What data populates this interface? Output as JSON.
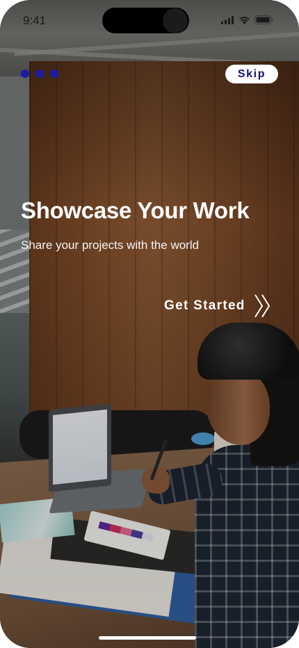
{
  "status_bar": {
    "time": "9:41"
  },
  "onboarding": {
    "page_indicator": {
      "total": 3,
      "active_index": 0,
      "color": "#1c1aa8"
    },
    "skip_label": "Skip",
    "title": "Showcase Your Work",
    "subtitle": "Share your projects with the world",
    "cta_label": "Get Started",
    "cta_icon": "double-chevron-right-icon"
  },
  "theme": {
    "skip_text_color": "#13127a",
    "text_color": "#ffffff"
  }
}
